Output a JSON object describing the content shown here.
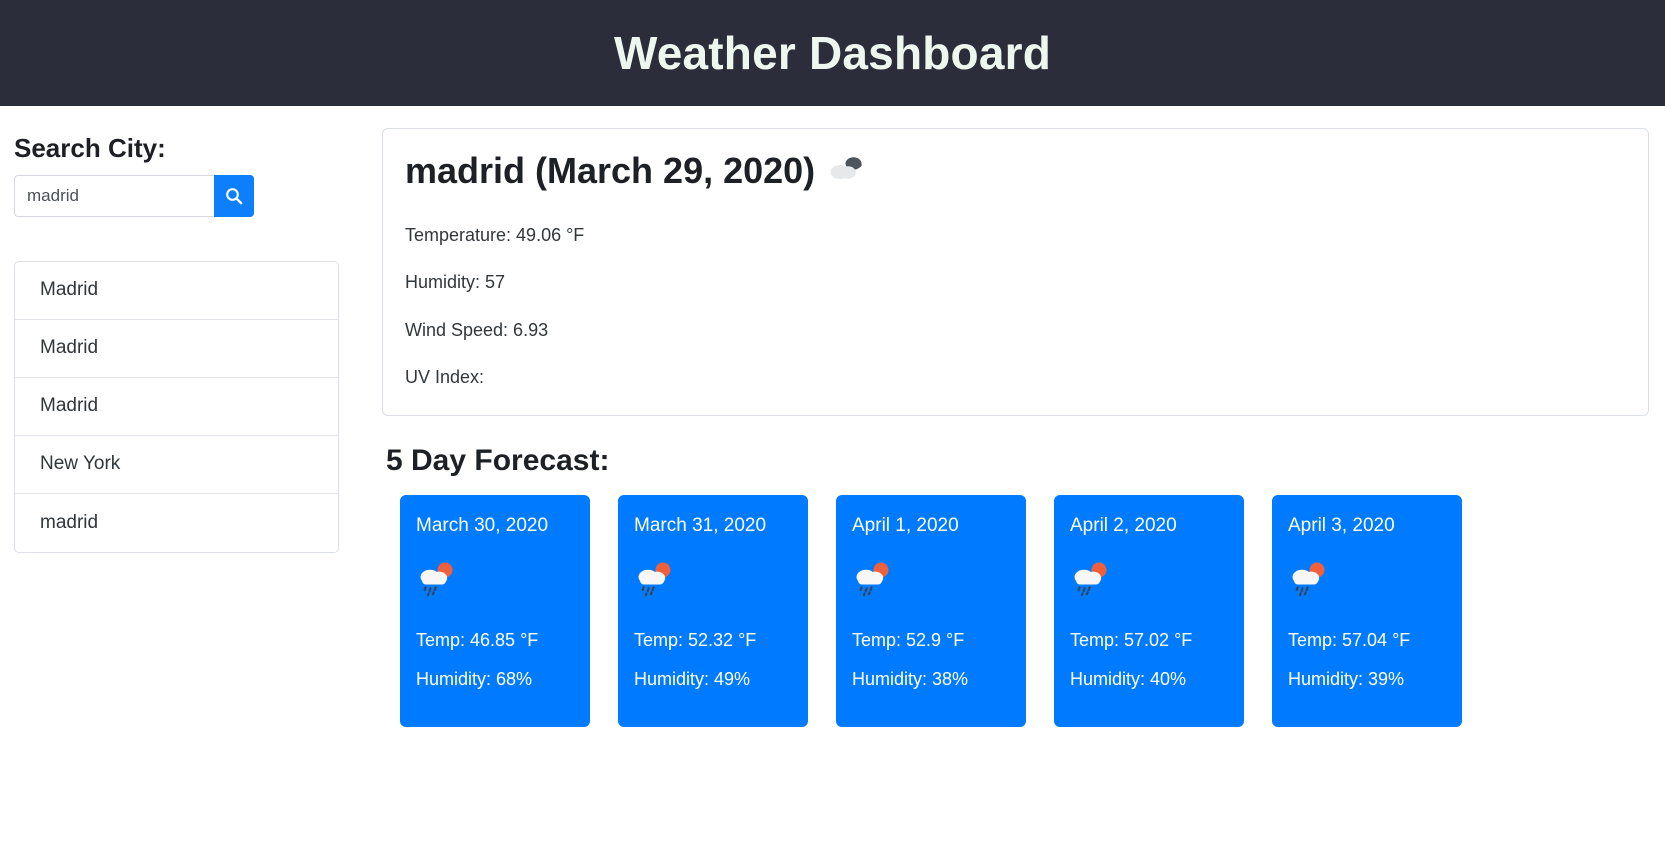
{
  "header": {
    "title": "Weather Dashboard",
    "background_color": "#2b2d3a",
    "title_color": "#eef7ee"
  },
  "sidebar": {
    "search_label": "Search City:",
    "search_input_value": "madrid",
    "search_input_placeholder": "",
    "search_button_icon": "search-icon",
    "accent_color": "#0d7efc",
    "history": [
      {
        "label": "Madrid"
      },
      {
        "label": "Madrid"
      },
      {
        "label": "Madrid"
      },
      {
        "label": "New York"
      },
      {
        "label": "madrid"
      }
    ]
  },
  "current": {
    "city": "madrid",
    "date": "March 29, 2020",
    "heading": "madrid (March 29, 2020)",
    "icon": "broken-clouds-icon",
    "temperature": "Temperature: 49.06 °F",
    "humidity": "Humidity: 57",
    "wind_speed": "Wind Speed: 6.93",
    "uv_index": "UV Index:"
  },
  "forecast": {
    "title": "5 Day Forecast:",
    "card_color": "#007bff",
    "days": [
      {
        "date": "March 30, 2020",
        "icon": "rain-with-sun-icon",
        "temp": "Temp: 46.85 °F",
        "humidity": "Humidity: 68%"
      },
      {
        "date": "March 31, 2020",
        "icon": "rain-with-sun-icon",
        "temp": "Temp: 52.32 °F",
        "humidity": "Humidity: 49%"
      },
      {
        "date": "April 1, 2020",
        "icon": "rain-with-sun-icon",
        "temp": "Temp: 52.9 °F",
        "humidity": "Humidity: 38%"
      },
      {
        "date": "April 2, 2020",
        "icon": "rain-with-sun-icon",
        "temp": "Temp: 57.02 °F",
        "humidity": "Humidity: 40%"
      },
      {
        "date": "April 3, 2020",
        "icon": "rain-with-sun-icon",
        "temp": "Temp: 57.04 °F",
        "humidity": "Humidity: 39%"
      }
    ]
  }
}
